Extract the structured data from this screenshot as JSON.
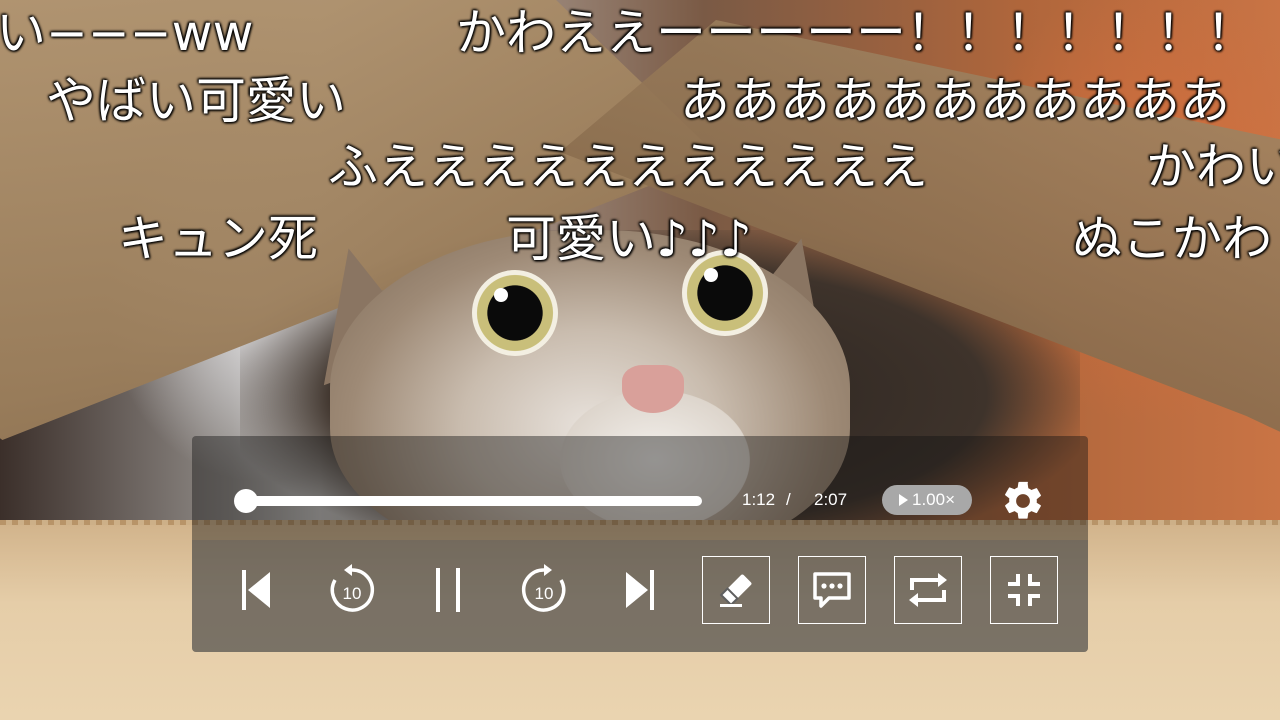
{
  "comments": [
    "い−−−ww",
    "かわええーーーーー！！！！！！！",
    "やばい可愛い",
    "あああああああああああ",
    "ふえええええええええええ",
    "かわい",
    "キュン死",
    "可愛い♪♪♪",
    "ぬこかわ"
  ],
  "player": {
    "current_time": "1:12",
    "separator": "/",
    "duration": "2:07",
    "progress_fraction": 0.0,
    "playback_speed": "1.00×"
  },
  "controls": {
    "rewind_seconds": "10",
    "forward_seconds": "10"
  },
  "icons": {
    "settings": "gear-icon",
    "skip_previous": "skip-previous-icon",
    "rewind": "rewind-10-icon",
    "pause": "pause-icon",
    "forward": "forward-10-icon",
    "skip_next": "skip-next-icon",
    "draw": "eraser-icon",
    "comments": "comment-icon",
    "repeat": "repeat-icon",
    "exit_fullscreen": "exit-fullscreen-icon"
  },
  "colors": {
    "comment_text": "#ffffff",
    "speed_badge": "#a8a8a8",
    "panel_top": "rgba(20,20,20,0.42)",
    "panel_bottom": "rgba(95,95,95,0.42)"
  }
}
